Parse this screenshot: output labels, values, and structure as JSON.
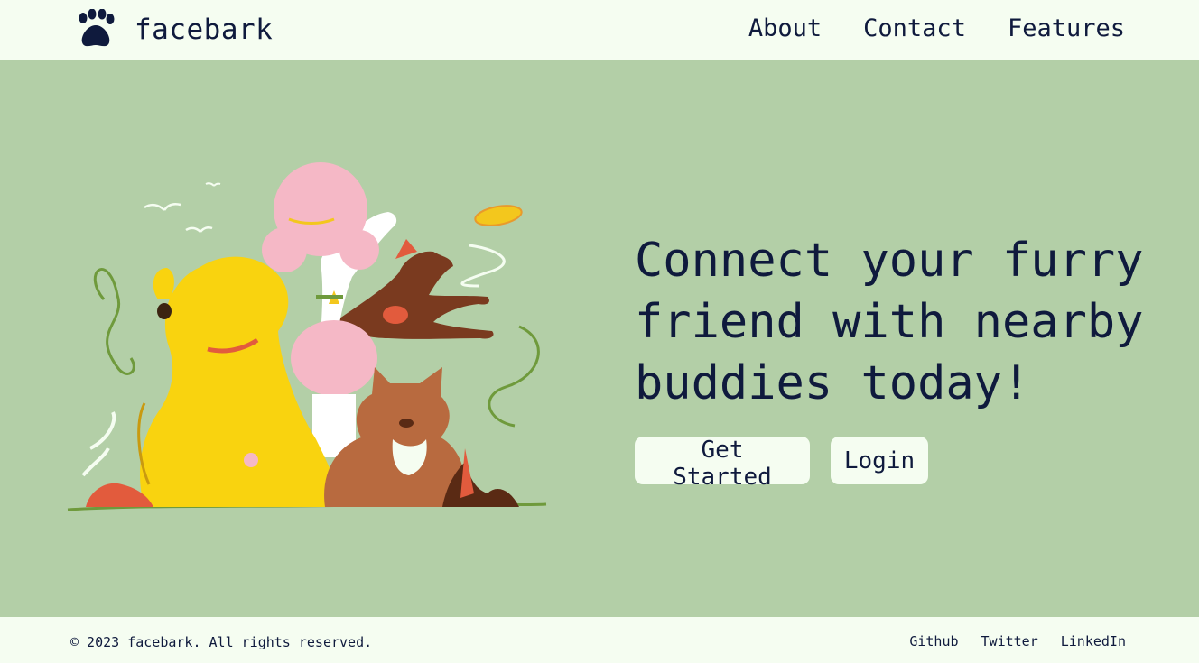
{
  "header": {
    "brand": "facebark",
    "nav": [
      {
        "label": "About"
      },
      {
        "label": "Contact"
      },
      {
        "label": "Features"
      }
    ]
  },
  "hero": {
    "headline_lines": [
      "Connect your furry",
      "friend with nearby",
      "buddies today!"
    ],
    "primary_button": "Get Started",
    "secondary_button": "Login",
    "illustration": "dogs-illustration"
  },
  "footer": {
    "copyright": "© 2023 facebark. All rights reserved.",
    "links": [
      {
        "label": "Github"
      },
      {
        "label": "Twitter"
      },
      {
        "label": "LinkedIn"
      }
    ]
  },
  "colors": {
    "primary_text": "#0f1a3d",
    "page_background": "#f5fdf1",
    "hero_background": "#b3cfa7"
  }
}
